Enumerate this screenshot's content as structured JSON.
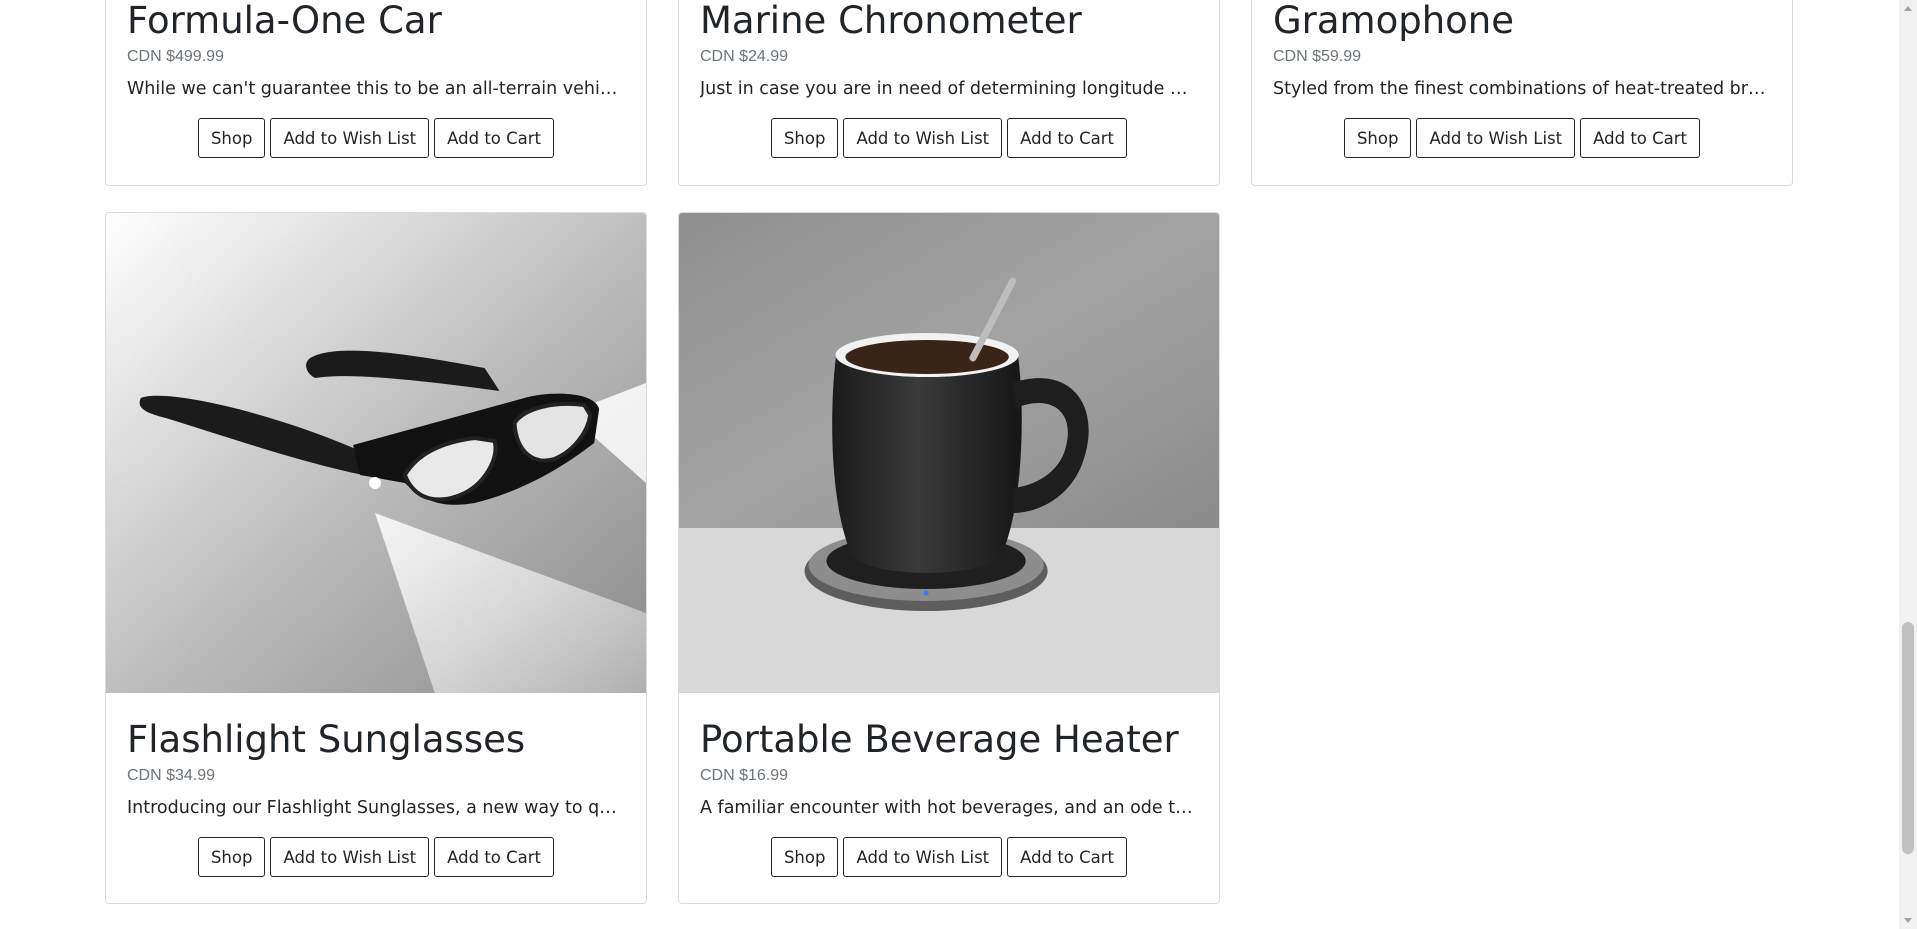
{
  "products": [
    {
      "title": "Formula-One Car",
      "price": "CDN $499.99",
      "description": "While we can't guarantee this to be an all-terrain vehicle wi…",
      "buttons": {
        "shop": "Shop",
        "wishlist": "Add to Wish List",
        "cart": "Add to Cart"
      }
    },
    {
      "title": "Marine Chronometer",
      "price": "CDN $24.99",
      "description": "Just in case you are in need of determining longitude aboar…",
      "buttons": {
        "shop": "Shop",
        "wishlist": "Add to Wish List",
        "cart": "Add to Cart"
      }
    },
    {
      "title": "Gramophone",
      "price": "CDN $59.99",
      "description": "Styled from the finest combinations of heat-treated brass, …",
      "buttons": {
        "shop": "Shop",
        "wishlist": "Add to Wish List",
        "cart": "Add to Cart"
      }
    },
    {
      "title": "Flashlight Sunglasses",
      "price": "CDN $34.99",
      "description": "Introducing our Flashlight Sunglasses, a new way to quickly…",
      "buttons": {
        "shop": "Shop",
        "wishlist": "Add to Wish List",
        "cart": "Add to Cart"
      }
    },
    {
      "title": "Portable Beverage Heater",
      "price": "CDN $16.99",
      "description": "A familiar encounter with hot beverages, and an ode to tha…",
      "buttons": {
        "shop": "Shop",
        "wishlist": "Add to Wish List",
        "cart": "Add to Cart"
      }
    }
  ]
}
